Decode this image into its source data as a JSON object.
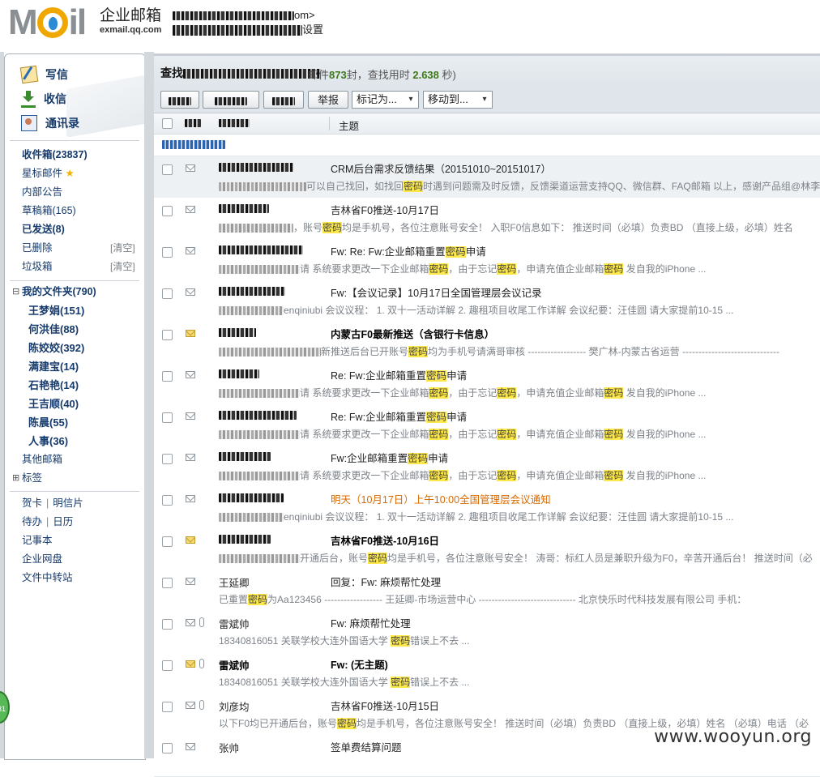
{
  "header": {
    "logo_text": "MOil",
    "brand_cn": "企业邮箱",
    "brand_en": "exmail.qq.com",
    "account_suffix": "om>",
    "settings_link": "设置"
  },
  "sidebar": {
    "tools": [
      {
        "label": "写信",
        "icon": "compose-icon"
      },
      {
        "label": "收信",
        "icon": "receive-icon"
      },
      {
        "label": "通讯录",
        "icon": "contacts-icon"
      }
    ],
    "folders": [
      {
        "label": "收件箱",
        "count": "(23837)",
        "bold": true
      },
      {
        "label": "星标邮件",
        "count": "",
        "star": "★"
      },
      {
        "label": "内部公告",
        "count": ""
      },
      {
        "label": "草稿箱",
        "count": "(165)"
      },
      {
        "label": "已发送",
        "count": "(8)",
        "bold": true
      },
      {
        "label": "已删除",
        "count": "",
        "clear": "[清空]"
      },
      {
        "label": "垃圾箱",
        "count": "",
        "clear": "[清空]"
      }
    ],
    "my_folders": {
      "toggle": "⊟",
      "label": "我的文件夹(790)"
    },
    "subfolders": [
      "王梦娟(151)",
      "何洪佳(88)",
      "陈姣姣(392)",
      "满建宝(14)",
      "石艳艳(14)",
      "王吉顺(40)",
      "陈晨(55)",
      "人事(36)"
    ],
    "other_mail": "其他邮箱",
    "tags": {
      "toggle": "⊞",
      "label": "标签"
    },
    "apps": [
      {
        "a": "贺卡",
        "b": "明信片"
      },
      {
        "a": "待办",
        "b": "日历"
      },
      {
        "a": "记事本"
      },
      {
        "a": "企业网盘"
      },
      {
        "a": "文件中转站"
      }
    ]
  },
  "main": {
    "title_prefix": "查找",
    "stats_prefix": "邮件",
    "stats_count": "873",
    "stats_mid": "封，查找用时",
    "stats_time": "2.638",
    "stats_suffix": "秒)",
    "toolbar": {
      "report": "举报",
      "mark_as": "标记为...",
      "move_to": "移动到..."
    },
    "list_header": {
      "subject": "主题"
    },
    "rows": [
      {
        "from": "",
        "subject": "CRM后台需求反馈结果（20151010~20151017）",
        "preview_pre": "可以自己找回，如找回",
        "kw": "密码",
        "preview_post": "时遇到问题需及时反馈，反馈渠道运营支持QQ、微信群、FAQ邮箱 以上，感谢产品组@林李",
        "bold": false,
        "highlight": true,
        "unread": false
      },
      {
        "from": "",
        "subject": "吉林省F0推送-10月17日",
        "preview_pre": "，账号",
        "kw": "密码",
        "preview_post": "均是手机号，各位注意账号安全！ 入职F0信息如下： 推送时间（必填）负责BD （直接上级，必填）姓名",
        "bold": false
      },
      {
        "from": "",
        "subject_pre": "Fw: Re: Fw:企业邮箱重置",
        "kw2": "密码",
        "subject_post": "申请",
        "preview_pre": "请 系统要求更改一下企业邮箱",
        "kw": "密码",
        "preview_mid": "，由于忘记",
        "kw3": "密码",
        "preview_mid2": "，申请充值企业邮箱",
        "kw4": "密码",
        "preview_post": " 发自我的iPhone ...",
        "bold": false
      },
      {
        "from": "",
        "subject": "Fw:【会议记录】10月17日全国管理层会议记录",
        "preview_pre": "enqiniubi 会议议程： 1. 双十一活动详解 2. 趣租项目收尾工作详解 会议纪要：汪佳圆 请大家提前10-15 ...",
        "bold": false
      },
      {
        "from": "",
        "subject": "内蒙古F0最新推送（含银行卡信息）",
        "preview_pre": "新推送后台已开账号",
        "kw": "密码",
        "preview_post": "均为手机号请满哥审核 ------------------ 樊广林-内蒙古省运营 ------------------------------",
        "bold": true,
        "unread": true
      },
      {
        "from": "",
        "subject_pre": "Re: Fw:企业邮箱重置",
        "kw2": "密码",
        "subject_post": "申请",
        "preview_pre": "请 系统要求更改一下企业邮箱",
        "kw": "密码",
        "preview_mid": "，由于忘记",
        "kw3": "密码",
        "preview_mid2": "，申请充值企业邮箱",
        "kw4": "密码",
        "preview_post": " 发自我的iPhone ...",
        "bold": false
      },
      {
        "from": "",
        "subject_pre": "Re: Fw:企业邮箱重置",
        "kw2": "密码",
        "subject_post": "申请",
        "preview_pre": "请 系统要求更改一下企业邮箱",
        "kw": "密码",
        "preview_mid": "，由于忘记",
        "kw3": "密码",
        "preview_mid2": "，申请充值企业邮箱",
        "kw4": "密码",
        "preview_post": " 发自我的iPhone ...",
        "bold": false
      },
      {
        "from": "",
        "subject_pre": "Fw:企业邮箱重置",
        "kw2": "密码",
        "subject_post": "申请",
        "preview_pre": "请 系统要求更改一下企业邮箱",
        "kw": "密码",
        "preview_mid": "，由于忘记",
        "kw3": "密码",
        "preview_mid2": "，申请充值企业邮箱",
        "kw4": "密码",
        "preview_post": " 发自我的iPhone ...",
        "bold": false
      },
      {
        "from": "",
        "subject": "明天（10月17日）上午10:00全国管理层会议通知",
        "preview_pre": "enqiniubi 会议议程： 1. 双十一活动详解 2. 趣租项目收尾工作详解 会议纪要：汪佳圆 请大家提前10-15 ...",
        "bold": false,
        "orange": true
      },
      {
        "from": "",
        "subject": "吉林省F0推送-10月16日",
        "preview_pre": "开通后台，账号",
        "kw": "密码",
        "preview_post": "均是手机号，各位注意账号安全！ 涛哥：标红人员是兼职升级为F0，辛苦开通后台！ 推送时间（必",
        "bold": true,
        "unread": true
      },
      {
        "from": "王延卿",
        "subject": "回复：Fw: 麻烦帮忙处理",
        "preview_pre": "已重置",
        "kw": "密码",
        "preview_post": "为Aa123456 ------------------ 王延卿-市场运营中心 ------------------------------ 北京快乐时代科技发展有限公司 手机：",
        "bold": false,
        "named": true
      },
      {
        "from": "雷斌帅",
        "subject": "Fw: 麻烦帮忙处理",
        "preview_pre": "18340816051 关联学校大连外国语大学 ",
        "kw": "密码",
        "preview_post": "错误上不去 ...",
        "bold": false,
        "named": true,
        "clip": true
      },
      {
        "from": "雷斌帅",
        "subject": "Fw: (无主题)",
        "preview_pre": "18340816051 关联学校大连外国语大学 ",
        "kw": "密码",
        "preview_post": "错误上不去 ...",
        "bold": true,
        "named": true,
        "clip": true,
        "unread": true
      },
      {
        "from": "刘彦均",
        "subject": "吉林省F0推送-10月15日",
        "preview_pre": "以下F0均已开通后台，账号",
        "kw": "密码",
        "preview_post": "均是手机号，各位注意账号安全！ 推送时间（必填）负责BD （直接上级，必填）姓名 （必填）电话 （必",
        "bold": false,
        "named": true,
        "clip": true
      },
      {
        "from": "张帅",
        "subject": "签单费结算问题",
        "preview_pre": "",
        "bold": false,
        "named": true
      }
    ]
  },
  "watermark": "www.wooyun.org",
  "notify_badge": "31"
}
